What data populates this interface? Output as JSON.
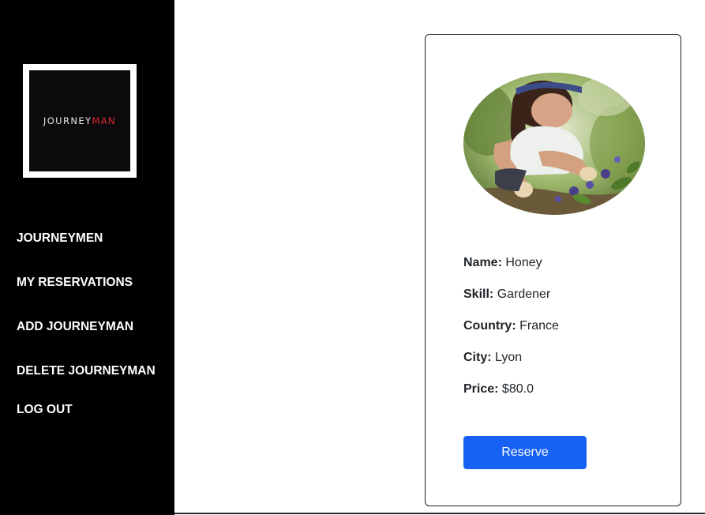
{
  "sidebar": {
    "logo": {
      "text_part1": "JOURNEY",
      "text_part2": "MAN",
      "text_color": "#e6e6e6",
      "accent_color": "#d8262c"
    },
    "nav": [
      {
        "label": "JOURNEYMEN"
      },
      {
        "label": "MY RESERVATIONS"
      },
      {
        "label": "ADD JOURNEYMAN"
      },
      {
        "label": "DELETE JOURNEYMAN"
      },
      {
        "label": "LOG OUT"
      }
    ]
  },
  "card": {
    "photo_alt": "gardener-photo",
    "details": [
      {
        "label": "Name:",
        "value": "Honey"
      },
      {
        "label": "Skill:",
        "value": "Gardener"
      },
      {
        "label": "Country:",
        "value": "France"
      },
      {
        "label": "City:",
        "value": "Lyon"
      },
      {
        "label": "Price:",
        "value": "$80.0"
      }
    ],
    "reserve_label": "Reserve",
    "button_color": "#1762f5"
  }
}
